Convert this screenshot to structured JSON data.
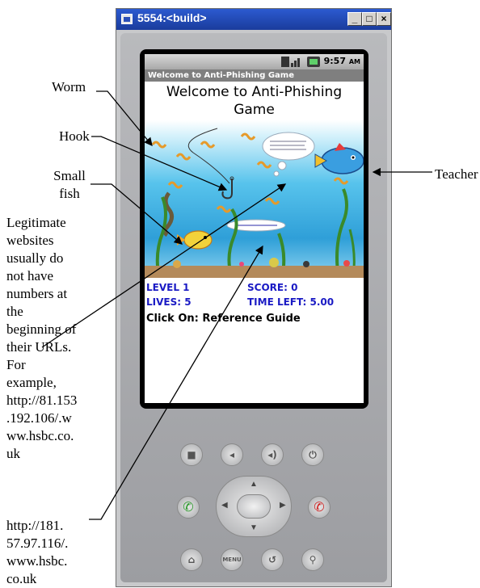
{
  "window": {
    "title": "5554:<build>",
    "controls": [
      "_",
      "□",
      "×"
    ]
  },
  "status_bar": {
    "network": "3G",
    "time": "9:57",
    "ampm": "AM"
  },
  "app": {
    "title_bar": "Welcome to Anti-Phishing Game",
    "heading_line1": "Welcome to Anti-Phishing",
    "heading_line2": "Game"
  },
  "game_info": {
    "level": "LEVEL 1",
    "score": "SCORE: 0",
    "lives": "LIVES: 5",
    "time_left": "TIME LEFT: 5.00",
    "click_on": "Click On: Reference Guide"
  },
  "phone_buttons": {
    "menu": "MENU"
  },
  "annotations": {
    "worm": "Worm",
    "hook": "Hook",
    "small_fish_1": "Small",
    "small_fish_2": "fish",
    "teacher": "Teacher",
    "legit_lines": [
      "Legitimate",
      "websites",
      "usually do",
      "not have",
      "numbers at",
      "the",
      "beginning of",
      "their URLs.",
      "For",
      "example,",
      "http://81.153",
      ".192.106/.w",
      "ww.hsbc.co.",
      "uk"
    ],
    "url_lines": [
      "http://181.",
      "57.97.116/.",
      "www.hsbc.",
      "co.uk"
    ]
  },
  "colors": {
    "info_blue": "#1a1ac4",
    "title_blue": "#2250c4",
    "water": "#3aaee0",
    "end_call_red": "#d02020",
    "call_green": "#2a9a2a"
  }
}
